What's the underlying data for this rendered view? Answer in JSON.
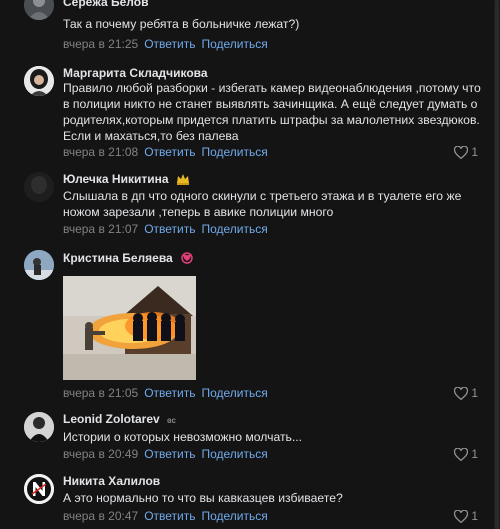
{
  "comments": [
    {
      "author": "Серёжа Белов",
      "text": "Так а почему ребята в больничке лежат?)",
      "time": "вчера в 21:25",
      "reply": "Ответить",
      "share": "Поделиться",
      "likes": ""
    },
    {
      "author": "Маргарита Складчикова",
      "text": "Правило любой разборки - избегать камер видеонаблюдения ,потому что в полиции никто не станет выявлять зачинщика. А ещё следует думать о родителях,которым придется платить штрафы за малолетних звездюков. Если и махаться,то без палева",
      "time": "вчера в 21:08",
      "reply": "Ответить",
      "share": "Поделиться",
      "likes": "1"
    },
    {
      "author": "Юлечка Никитина",
      "text": "Слышала в дп что одного скинули с третьего этажа и в туалете его же ножом зарезали ,теперь в авике полиции много",
      "time": "вчера в 21:07",
      "reply": "Ответить",
      "share": "Поделиться",
      "likes": "",
      "badge_icon": "crown-icon"
    },
    {
      "author": "Кристина Беляева",
      "text": "",
      "time": "вчера в 21:05",
      "reply": "Ответить",
      "share": "Поделиться",
      "likes": "1",
      "badge_icon": "heart-ring-icon"
    },
    {
      "author": "Leonid Zolotarev",
      "text": "Истории о которых невозможно молчать...",
      "time": "вчера в 20:49",
      "reply": "Ответить",
      "share": "Поделиться",
      "likes": "1",
      "badge_icon": "small-mark-icon"
    },
    {
      "author": "Никита Халилов",
      "text": "А это нормально то что вы кавказцев избиваете?",
      "time": "вчера в 20:47",
      "reply": "Ответить",
      "share": "Поделиться",
      "likes": "1"
    }
  ],
  "colors": {
    "background": "#141414",
    "link": "#71aaeb",
    "meta": "#828282",
    "text": "#e1e3e6"
  }
}
